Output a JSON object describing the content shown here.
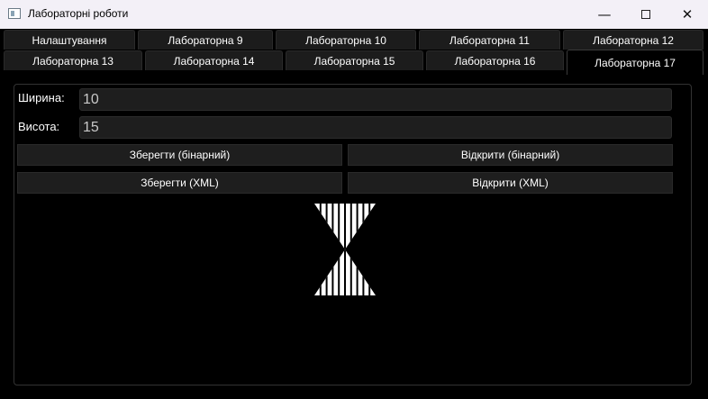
{
  "window": {
    "title": "Лабораторні роботи",
    "controls": {
      "minimize": "—",
      "close": "✕"
    }
  },
  "tabs_row1": [
    "Налаштування",
    "Лабораторна 9",
    "Лабораторна 10",
    "Лабораторна 11",
    "Лабораторна 12"
  ],
  "tabs_row2": [
    "Лабораторна 13",
    "Лабораторна 14",
    "Лабораторна 15",
    "Лабораторна 16",
    "Лабораторна 17"
  ],
  "active_tab": "Лабораторна 17",
  "form": {
    "width_label": "Ширина:",
    "width_value": "10",
    "height_label": "Висота:",
    "height_value": "15"
  },
  "buttons": {
    "save_binary": "Зберегти (бінарний)",
    "open_binary": "Відкрити (бінарний)",
    "save_xml": "Зберегти (XML)",
    "open_xml": "Відкрити (XML)"
  },
  "figure": {
    "shape": "hourglass",
    "stripes": 10,
    "fill": "#ffffff",
    "stripe_color": "#000000"
  }
}
